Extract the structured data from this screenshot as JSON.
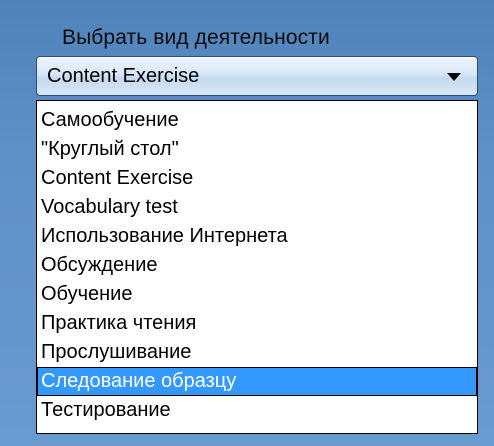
{
  "section": {
    "title": "Выбрать вид деятельности"
  },
  "combo": {
    "selected_value": "Content Exercise",
    "arrow_icon": "chevron-down-icon"
  },
  "dropdown": {
    "items": [
      {
        "label": "Самообучение"
      },
      {
        "label": "\"Круглый стол\""
      },
      {
        "label": "Content Exercise"
      },
      {
        "label": "Vocabulary test"
      },
      {
        "label": "Использование Интернета"
      },
      {
        "label": "Обсуждение"
      },
      {
        "label": "Обучение"
      },
      {
        "label": "Практика чтения"
      },
      {
        "label": "Прослушивание"
      },
      {
        "label": "Следование образцу"
      },
      {
        "label": "Тестирование"
      }
    ],
    "highlighted_index": 9
  },
  "colors": {
    "background": "#5b8cc0",
    "highlight": "#3399ff"
  }
}
